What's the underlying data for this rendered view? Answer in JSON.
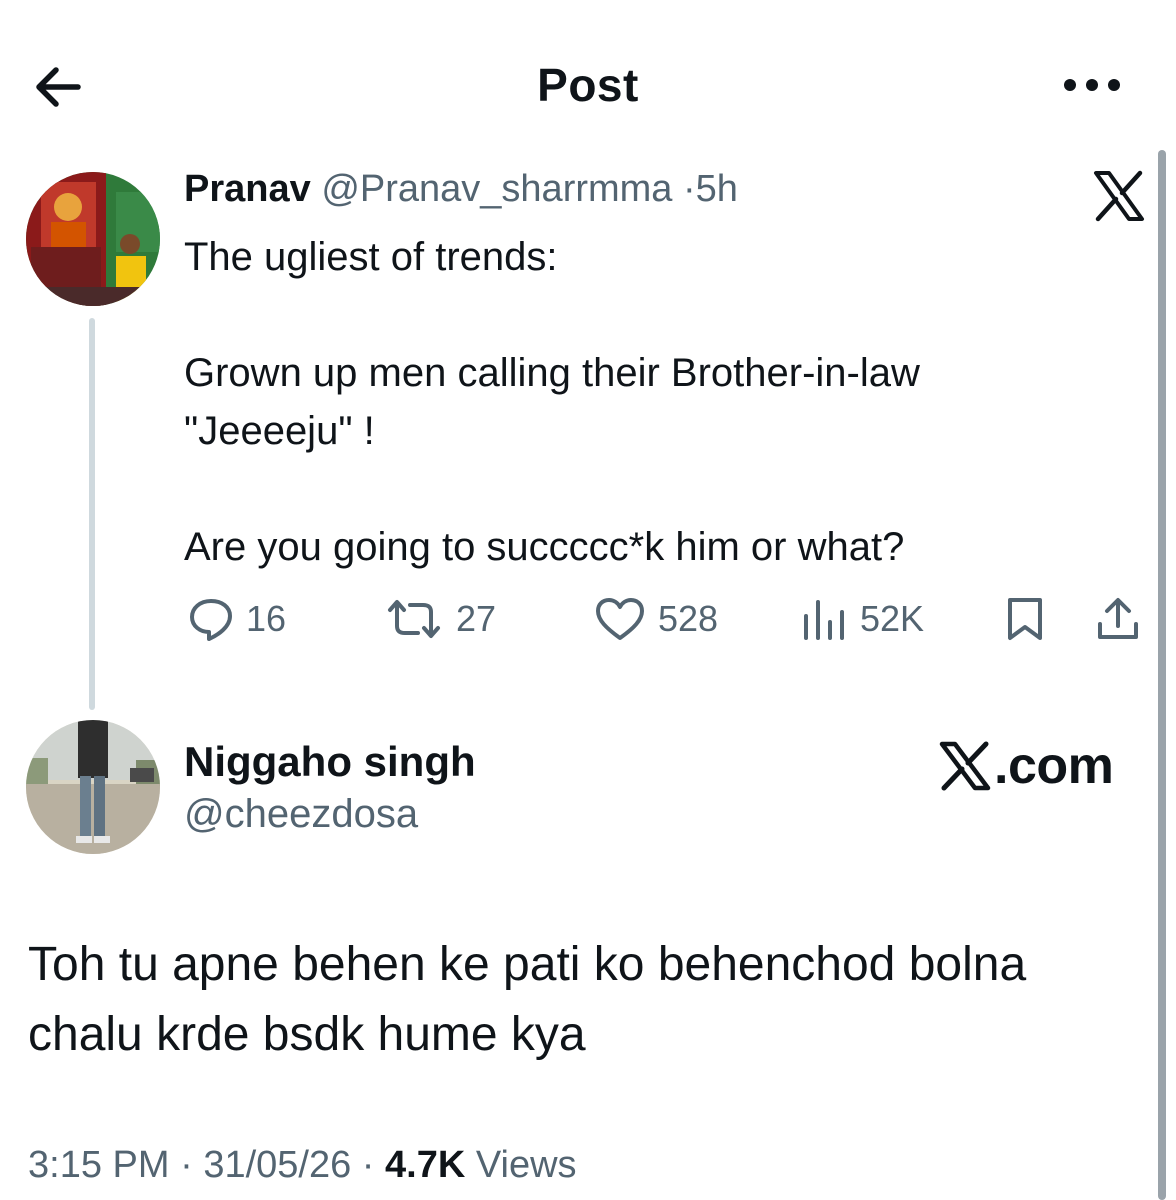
{
  "header": {
    "title": "Post",
    "back_icon": "arrow-left-icon",
    "more_icon": "more-horizontal-icon"
  },
  "quoted_post": {
    "display_name": "Pranav",
    "handle": "@Pranav_sharrmma",
    "separator": "·",
    "time": "5h",
    "lines": [
      "The ugliest of trends:",
      "",
      "Grown up men calling their Brother-in-law",
      "\"Jeeeeju\" !",
      "",
      "Are you going to succccc*k him or what?"
    ],
    "actions": {
      "replies": "16",
      "reposts": "27",
      "likes": "528",
      "views": "52K"
    },
    "platform_icon": "x-logo-icon"
  },
  "reply_post": {
    "display_name": "Niggaho singh",
    "handle": "@cheezdosa",
    "watermark_suffix": ".com",
    "lines": [
      "Toh tu apne behen ke pati ko behenchod bolna",
      "chalu krde bsdk hume kya"
    ],
    "footer": {
      "time": "3:15 PM",
      "sep1": " · ",
      "date": "31/05/26",
      "sep2": " · ",
      "views_count": "4.7K",
      "views_label": " Views"
    }
  },
  "colors": {
    "text_primary": "#0f1419",
    "text_secondary": "#536471",
    "thread_line": "#cfd9de",
    "background": "#ffffff"
  }
}
